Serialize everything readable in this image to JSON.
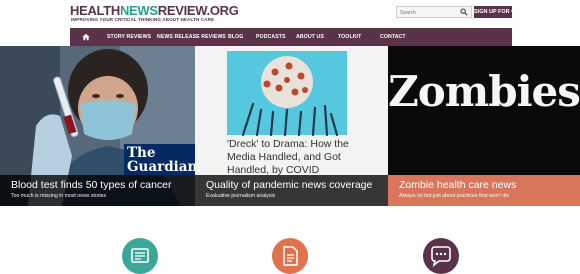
{
  "site": {
    "logo_part1": "HEALTH",
    "logo_part2": "NEWS",
    "logo_part3": "REVIEW.ORG",
    "tagline": "IMPROVING YOUR CRITICAL THINKING ABOUT HEALTH CARE"
  },
  "search": {
    "placeholder": "Search"
  },
  "header": {
    "signup_label": "SIGN UP FOR ▾"
  },
  "nav": {
    "items": [
      {
        "label": "STORY REVIEWS"
      },
      {
        "label": "NEWS RELEASE REVIEWS"
      },
      {
        "label": "BLOG"
      },
      {
        "label": "PODCASTS"
      },
      {
        "label": "ABOUT US"
      },
      {
        "label": "TOOLKIT"
      },
      {
        "label": "CONTACT"
      }
    ]
  },
  "hero": {
    "slides": [
      {
        "title": "Blood test finds 50 types of cancer",
        "subtitle": "Too much is missing in most news stories",
        "badge": "The Guardian"
      },
      {
        "title": "Quality of pandemic news coverage",
        "subtitle": "Evaluative journalism analysis",
        "inner_title": "'Dreck' to Drama: How the Media Handled, and Got Handled, by COVID"
      },
      {
        "title": "Zombie health care news",
        "subtitle": "Always on but just about practices that won't die",
        "badge": "Zombies"
      }
    ]
  },
  "colors": {
    "brand": "#5b3349",
    "teal": "#2b9e8f",
    "orange": "#e2724e",
    "zombie_caption": "#d9755a"
  },
  "icons": [
    {
      "name": "newspaper-icon"
    },
    {
      "name": "document-icon"
    },
    {
      "name": "speech-bubble-icon"
    }
  ]
}
